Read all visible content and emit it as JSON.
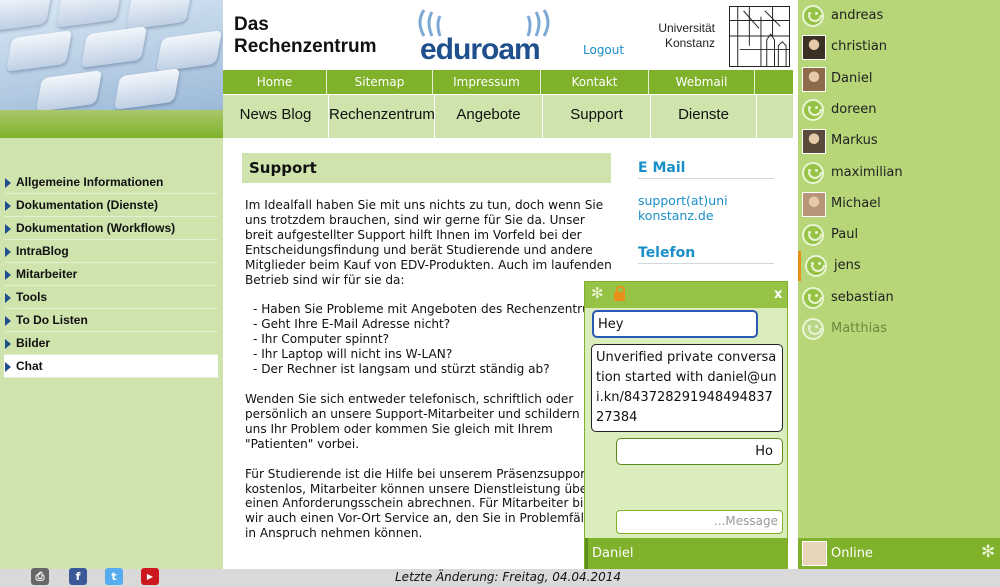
{
  "header": {
    "title_line1": "Das",
    "title_line2": "Rechenzentrum",
    "eduroam_logo": "eduroam",
    "logout": "Logout",
    "university_line1": "Universität",
    "university_line2": "Konstanz"
  },
  "topnav": [
    "Home",
    "Sitemap",
    "Impressum",
    "Kontakt",
    "Webmail"
  ],
  "subnav": [
    "News Blog",
    "Rechenzentrum",
    "Angebote",
    "Support",
    "Dienste"
  ],
  "sidebar": {
    "items": [
      {
        "label": "Allgemeine Informationen"
      },
      {
        "label": "Dokumentation (Dienste)"
      },
      {
        "label": "Dokumentation (Workflows)"
      },
      {
        "label": "IntraBlog"
      },
      {
        "label": "Mitarbeiter"
      },
      {
        "label": "Tools"
      },
      {
        "label": "To Do Listen"
      },
      {
        "label": "Bilder"
      },
      {
        "label": "Chat"
      }
    ],
    "active": "Chat"
  },
  "main": {
    "heading": "Support",
    "p1": [
      "Im Idealfall haben Sie mit uns nichts zu tun, doch wenn Sie",
      "uns trotzdem brauchen, sind wir gerne für Sie da. Unser",
      "breit aufgestellter Support hilft Ihnen im Vorfeld bei der",
      "Entscheidungsfindung und berät Studierende und andere",
      "Mitglieder beim Kauf von EDV-Produkten. Auch im laufenden",
      "Betrieb sind wir für sie da:"
    ],
    "bullets": [
      "- Haben Sie Probleme mit Angeboten des Rechenzentrums",
      "- Geht Ihre E-Mail Adresse nicht?",
      "- Ihr Computer spinnt?",
      "- Ihr Laptop will nicht ins W-LAN?",
      "- Der Rechner ist langsam und stürzt ständig ab?"
    ],
    "p2": [
      "Wenden Sie sich entweder telefonisch, schriftlich oder",
      "persönlich an unsere Support-Mitarbeiter und schildern Sie",
      "uns Ihr Problem oder kommen Sie gleich mit Ihrem",
      "\"Patienten\" vorbei."
    ],
    "p3": [
      "Für Studierende ist die Hilfe bei unserem Präsenzsupport",
      "kostenlos, Mitarbeiter können unsere Dienstleistung über",
      "einen Anforderungsschein abrechnen. Für Mitarbeiter bietet",
      "wir auch einen Vor-Ort Service an, den Sie in Problemfällen",
      "in Anspruch nehmen können."
    ]
  },
  "right_col": {
    "email_heading": "E Mail",
    "email_line1": "support(at)uni",
    "email_line2": "konstanz.de",
    "phone_heading": "Telefon"
  },
  "footer": {
    "text": "Letzte Änderung: Freitag, 04.04.2014",
    "icons": [
      "printer-icon",
      "facebook-icon",
      "twitter-icon",
      "youtube-icon"
    ]
  },
  "buddies": [
    {
      "name": "andreas",
      "icon": "smiley"
    },
    {
      "name": "christian",
      "icon": "avatar",
      "color": "#3a3024"
    },
    {
      "name": "Daniel",
      "icon": "avatar",
      "color": "#8c6a4a"
    },
    {
      "name": "doreen",
      "icon": "smiley"
    },
    {
      "name": "Markus",
      "icon": "avatar",
      "color": "#5a4a3c"
    },
    {
      "name": "maximilian",
      "icon": "smiley"
    },
    {
      "name": "Michael",
      "icon": "avatar",
      "color": "#b89478"
    },
    {
      "name": "Paul",
      "icon": "smiley"
    },
    {
      "name": "jens",
      "icon": "smiley"
    },
    {
      "name": "sebastian",
      "icon": "smiley"
    },
    {
      "name": "Matthias",
      "icon": "smiley",
      "offline": true
    }
  ],
  "online": {
    "label": "Online"
  },
  "chat_window": {
    "close": "x",
    "messages": [
      {
        "text": "Hey"
      },
      {
        "text": "Unverified private conversation started with daniel@uni.kn/84372829194849483727384"
      },
      {
        "text": "Ho"
      }
    ],
    "input_placeholder": "...Message",
    "partner": "Daniel"
  },
  "colors": {
    "green": "#7fb12b",
    "light_green": "#cfe3ad",
    "chat_green": "#b6d678",
    "link_blue": "#1a8fc8",
    "navy": "#1f4f8c"
  }
}
